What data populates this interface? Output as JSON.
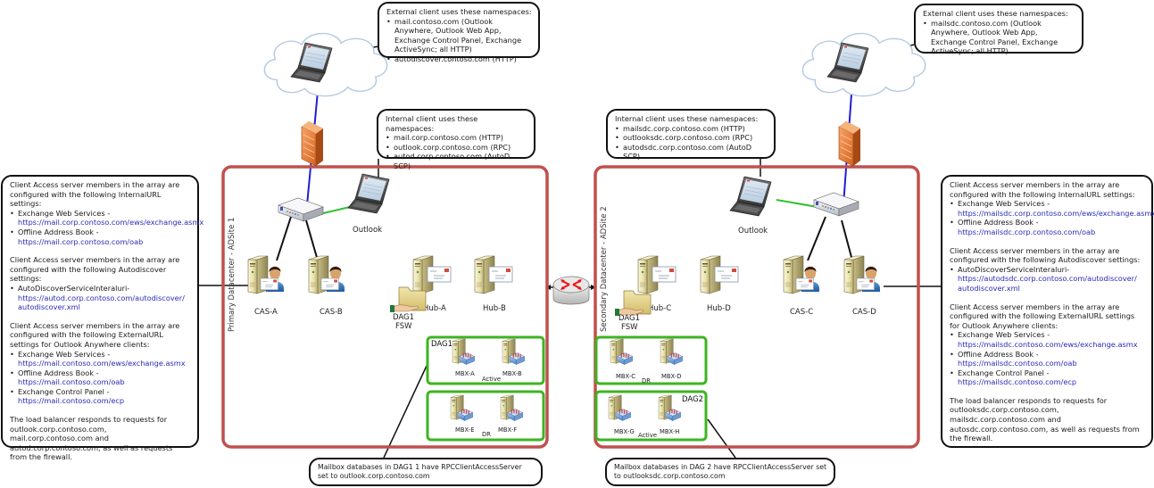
{
  "colors": {
    "datacenter_border": "#c0504d",
    "dag_border": "#3cb521",
    "wan_link": "#1f1fd6",
    "lan_link": "#30c030",
    "url_text": "#2b2bb8"
  },
  "datacenters": [
    {
      "label": "Primary Datacenter - ADSite 1"
    },
    {
      "label": "Secondary Datacenter - ADSite 2"
    }
  ],
  "nodes": {
    "outlook_left": "Outlook",
    "outlook_right": "Outlook",
    "cas_a": "CAS-A",
    "cas_b": "CAS-B",
    "cas_c": "CAS-C",
    "cas_d": "CAS-D",
    "hub_a": "Hub-A",
    "hub_b": "Hub-B",
    "hub_c": "Hub-C",
    "hub_d": "Hub-D",
    "fsw_left_line1": "DAG1",
    "fsw_left_line2": "FSW",
    "fsw_right_line1": "DAG1",
    "fsw_right_line2": "FSW"
  },
  "dags": {
    "dag1_label": "DAG1",
    "dag2_label": "DAG2",
    "dag1_site1": {
      "servers": [
        "MBX-A",
        "MBX-B"
      ],
      "state": "Active"
    },
    "dag1_site2": {
      "servers": [
        "MBX-C",
        "MBX-D"
      ],
      "state": "DR"
    },
    "dag2_site1": {
      "servers": [
        "MBX-E",
        "MBX-F"
      ],
      "state": "DR"
    },
    "dag2_site2": {
      "servers": [
        "MBX-G",
        "MBX-H"
      ],
      "state": "Active"
    }
  },
  "callouts": {
    "external_left": {
      "title": "External client uses these namespaces:",
      "items": [
        "mail.contoso.com (Outlook Anywhere, Outlook Web App, Exchange Control Panel, Exchange ActiveSync; all HTTP)",
        "autodiscover.contoso.com (HTTP)"
      ]
    },
    "external_right": {
      "title": "External client uses these namespaces:",
      "items": [
        "mailsdc.contoso.com (Outlook Anywhere, Outlook Web App, Exchange Control Panel, Exchange ActiveSync; all HTTP)"
      ]
    },
    "internal_left": {
      "title": "Internal client uses these namespaces:",
      "items": [
        "mail.corp.contoso.com (HTTP)",
        "outlook.corp.contoso.com (RPC)",
        "autod.corp.contoso.com (AutoD SCP)"
      ]
    },
    "internal_right": {
      "title": "Internal client uses these namespaces:",
      "items": [
        "mailsdc.corp.contoso.com (HTTP)",
        "outlooksdc.corp.contoso.com (RPC)",
        "autodsdc.corp.contoso.com (AutoD SCP)"
      ]
    },
    "cas_left": {
      "internal_intro": "Client Access server members in the array are configured with the following InternalURL settings:",
      "internal_items": [
        {
          "label": "Exchange Web Services -",
          "url": "https://mail.corp.contoso.com/ews/exchange.asmx"
        },
        {
          "label": "Offline Address Book -",
          "url": "https://mail.corp.contoso.com/oab"
        }
      ],
      "autod_intro": "Client Access server members in the array are configured with the following Autodiscover settings:",
      "autod_items": [
        {
          "label": "AutoDiscoverServiceInteraluri-",
          "url": "https://autod.corp.contoso.com/autodiscover/ autodiscover.xml"
        }
      ],
      "external_intro": "Client Access server members in the array are configured with the following ExternalURL settings for Outlook Anywhere clients:",
      "external_items": [
        {
          "label": "Exchange Web Services -",
          "url": "https://mail.contoso.com/ews/exchange.asmx"
        },
        {
          "label": "Offline Address Book -",
          "url": "https://mail.contoso.com/oab"
        },
        {
          "label": "Exchange Control Panel -",
          "url": "https://mail.contoso.com/ecp"
        }
      ],
      "lb_note": "The load balancer responds to requests for outlook.corp.contoso.com, mail.corp.contoso.com and autod.corp.contoso.com, as well as requests from the firewall."
    },
    "cas_right": {
      "internal_intro": "Client Access server members in the array are configured with the following InternalURL settings:",
      "internal_items": [
        {
          "label": "Exchange Web Services -",
          "url": "https://mailsdc.corp.contoso.com/ews/exchange.asmx"
        },
        {
          "label": "Offline Address Book -",
          "url": "https://mailsdc.corp.contoso.com/oab"
        }
      ],
      "autod_intro": "Client Access server members in the array are configured with the following Autodiscover settings:",
      "autod_items": [
        {
          "label": "AutoDiscoverServiceInteraluri-",
          "url": "https://autodsdc.corp.contoso.com/autodiscover/ autodiscover.xml"
        }
      ],
      "external_intro": "Client Access server members in the array are configured with the following ExternalURL settings for Outlook Anywhere clients:",
      "external_items": [
        {
          "label": "Exchange Web Services -",
          "url": "https://mailsdc.contoso.com/ews/exchange.asmx"
        },
        {
          "label": "Offline Address Book -",
          "url": "https://mailsdc.contoso.com/oab"
        },
        {
          "label": "Exchange Control Panel -",
          "url": "https://mailsdc.contoso.com/ecp"
        }
      ],
      "lb_note": "The load balancer responds to requests for outlooksdc.corp.contoso.com, mailsdc.corp.contoso.com and autosdc.corp.contoso.com, as well as requests from the firewall."
    },
    "dag1_note": "Mailbox databases in DAG1 1 have RPCClientAccessServer set to outlook.corp.contoso.com",
    "dag2_note": "Mailbox databases in DAG 2 have RPCClientAccessServer set to outlooksdc.corp.contoso.com"
  }
}
